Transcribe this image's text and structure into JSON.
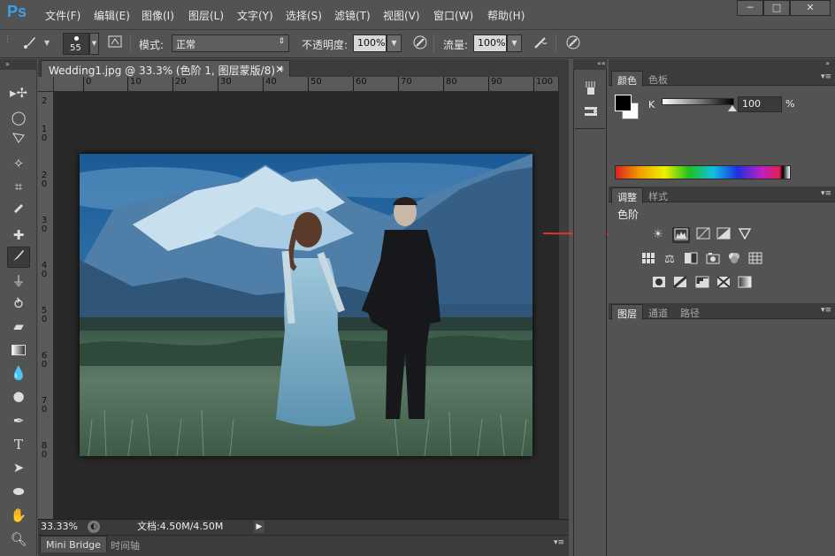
{
  "app": {
    "logo": "Ps"
  },
  "menu": [
    "文件(F)",
    "编辑(E)",
    "图像(I)",
    "图层(L)",
    "文字(Y)",
    "选择(S)",
    "滤镜(T)",
    "视图(V)",
    "窗口(W)",
    "帮助(H)"
  ],
  "window_controls": {
    "minimize": "─",
    "maximize": "□",
    "close": "✕"
  },
  "options": {
    "brush_size": "55",
    "mode_label": "模式:",
    "mode_value": "正常",
    "opacity_label": "不透明度:",
    "opacity_value": "100%",
    "flow_label": "流量:",
    "flow_value": "100%"
  },
  "document": {
    "tab_title": "Wedding1.jpg @ 33.3% (色阶 1, 图层蒙版/8) *",
    "tab_close": "×",
    "ruler_top": [
      "0",
      "10",
      "20",
      "30",
      "40",
      "50",
      "60",
      "70",
      "80",
      "90",
      "100"
    ],
    "ruler_left": [
      [
        "2"
      ],
      [
        "1",
        "0"
      ],
      [
        "2",
        "0"
      ],
      [
        "3",
        "0"
      ],
      [
        "4",
        "0"
      ],
      [
        "5",
        "0"
      ],
      [
        "6",
        "0"
      ],
      [
        "7",
        "0"
      ],
      [
        "8",
        "0"
      ]
    ]
  },
  "status": {
    "zoom": "33.33%",
    "doc_info": "文档:4.50M/4.50M",
    "arrow": "▶"
  },
  "bottom_tabs": [
    "Mini Bridge",
    "时间轴"
  ],
  "color_panel": {
    "tabs": [
      "颜色",
      "色板"
    ],
    "channel_label": "K",
    "channel_value": "100",
    "unit": "%",
    "slider_level": 1.0,
    "fg_color": "#000000",
    "bg_color": "#ffffff"
  },
  "adjustments_panel": {
    "tabs": [
      "调整",
      "样式"
    ],
    "current": "色阶"
  },
  "layers_panel": {
    "tabs": [
      "图层",
      "通道",
      "路径"
    ]
  },
  "colors": {
    "ui_bg": "#535353",
    "dark": "#282828",
    "accent": "#3aa0e8",
    "arrow": "#e53030"
  }
}
